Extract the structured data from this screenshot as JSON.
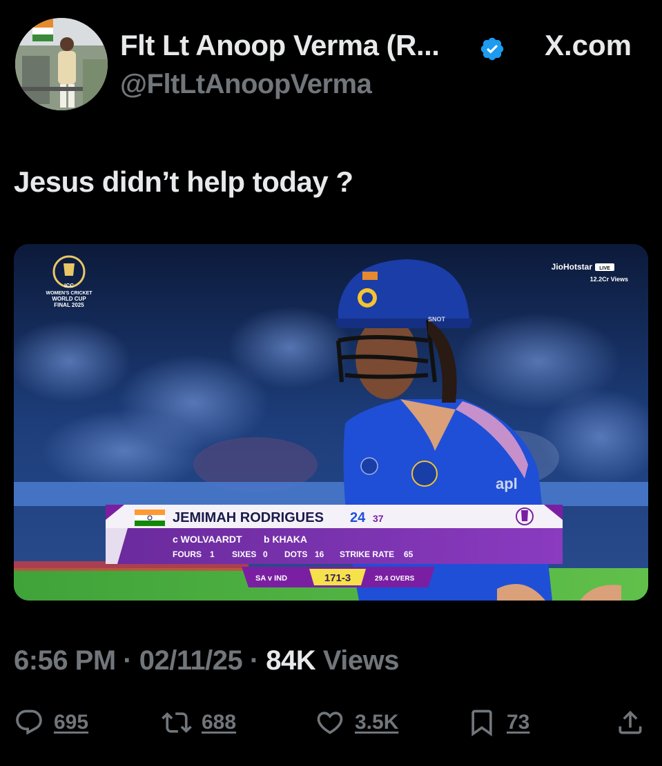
{
  "author": {
    "display_name": "Flt Lt Anoop Verma (R...",
    "handle": "@FltLtAnoopVerma",
    "verified": true
  },
  "site": "X.com",
  "tweet": {
    "text": "Jesus didn’t help today ?"
  },
  "media": {
    "event_logo_lines": [
      "ICC",
      "WOMEN'S CRICKET",
      "WORLD CUP",
      "FINAL 2025"
    ],
    "broadcaster": "JioHotstar",
    "live_badge": "LIVE",
    "viewers": "12.2Cr Views",
    "jersey_sponsor": "apl",
    "helmet_text": "SNOT",
    "scoreboard": {
      "player_name": "JEMIMAH RODRIGUES",
      "runs": "24",
      "balls": "37",
      "dismissal_c": "c WOLVAARDT",
      "dismissal_b": "b KHAKA",
      "fours_label": "FOURS",
      "fours": "1",
      "sixes_label": "SIXES",
      "sixes": "0",
      "dots_label": "DOTS",
      "dots": "16",
      "sr_label": "STRIKE RATE",
      "sr": "65",
      "match": "SA v IND",
      "score": "171-3",
      "overs": "29.4 OVERS"
    }
  },
  "meta": {
    "time": "6:56 PM",
    "date": "02/11/25",
    "views_count": "84K",
    "views_label": "Views"
  },
  "actions": {
    "replies": "695",
    "reposts": "688",
    "likes": "3.5K",
    "bookmarks": "73"
  },
  "colors": {
    "background": "#000000",
    "text": "#e7e9ea",
    "muted": "#71767b",
    "verified": "#1d9bf0",
    "scoreboard_purple": "#7b1fa2",
    "score_yellow": "#f5e14a"
  }
}
